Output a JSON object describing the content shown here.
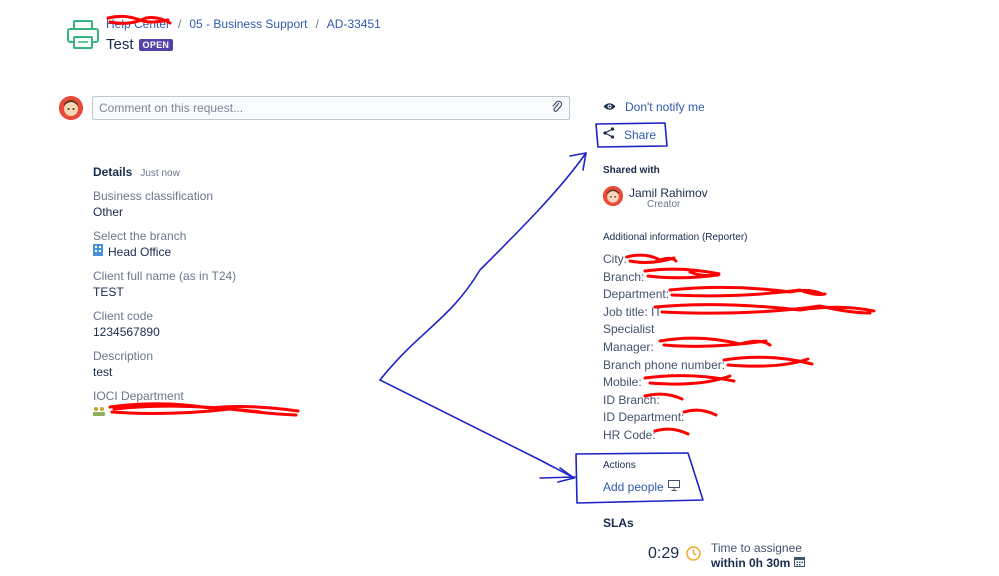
{
  "header": {
    "breadcrumb": [
      "Help Center",
      "05 - Business Support",
      "AD-33451"
    ],
    "separator": "/",
    "title": "Test",
    "status": "OPEN"
  },
  "comment": {
    "placeholder": "Comment on this request..."
  },
  "details": {
    "heading": "Details",
    "time": "Just now",
    "fields": [
      {
        "label": "Business classification",
        "value": "Other"
      },
      {
        "label": "Select the branch",
        "value": "Head Office"
      },
      {
        "label": "Client full name (as in T24)",
        "value": "TEST"
      },
      {
        "label": "Client code",
        "value": "1234567890"
      },
      {
        "label": "Description",
        "value": "test"
      },
      {
        "label": "IOCI Department",
        "value": ""
      }
    ]
  },
  "sidebar": {
    "notify_label": "Don't notify me",
    "share_label": "Share",
    "shared_with_heading": "Shared with",
    "person_name": "Jamil Rahimov",
    "person_role": "Creator",
    "additional_heading": "Additional information (Reporter)",
    "info": [
      "City:",
      "Branch:",
      "Department:",
      "Job title: IT",
      "Specialist",
      "Manager:",
      "Branch phone number:",
      "Mobile:",
      "ID Branch:",
      "ID Department:",
      "HR Code:"
    ],
    "actions_heading": "Actions",
    "add_people_label": "Add people",
    "slas_heading": "SLAs",
    "sla_time": "0:29",
    "sla_label": "Time to assignee",
    "sla_target": "within 0h 30m"
  },
  "colors": {
    "link": "#2e5aac",
    "badge": "#5243aa",
    "annotation": "#1e22c8",
    "redaction": "#ff0000",
    "clock": "#f5a623"
  },
  "icons": [
    "printer-icon",
    "avatar-icon",
    "paperclip-icon",
    "eye-icon",
    "share-icon",
    "office-icon",
    "department-icon",
    "screen-icon",
    "clock-icon",
    "calendar-icon"
  ]
}
